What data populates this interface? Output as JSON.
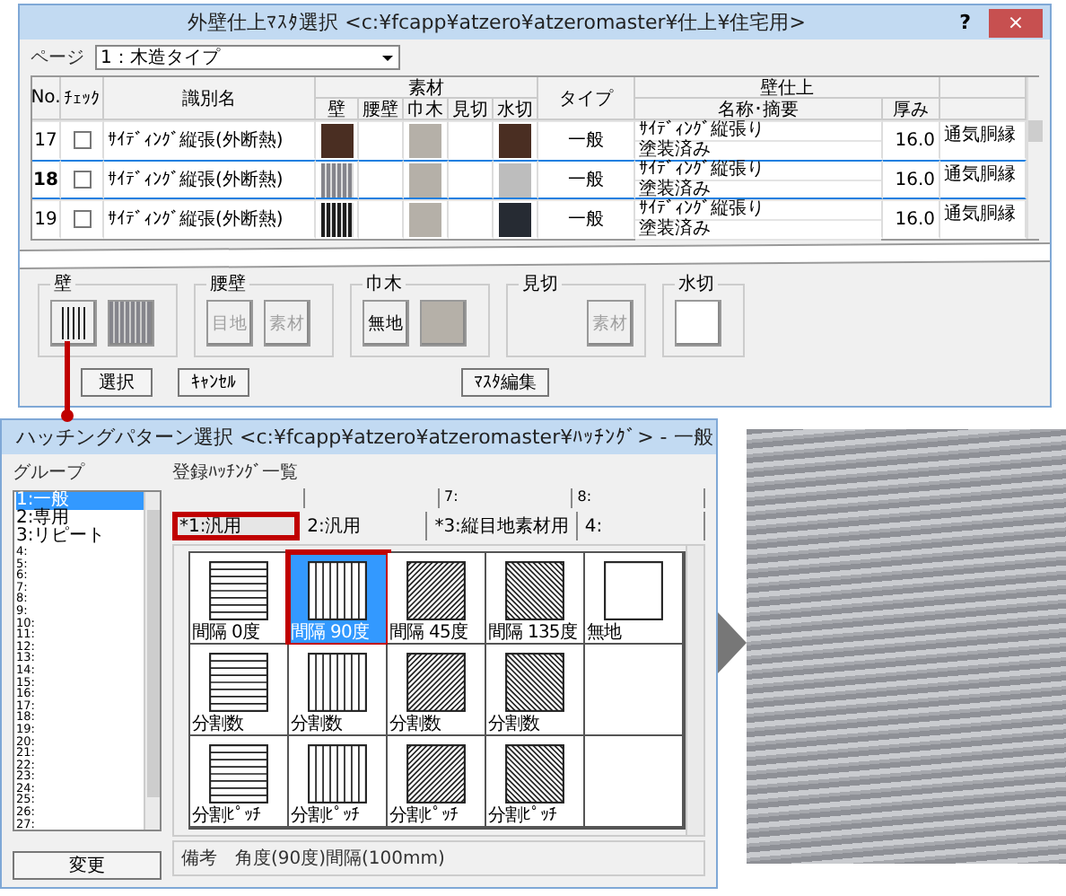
{
  "master_dialog": {
    "title": "外壁仕上ﾏｽﾀ選択 <c:¥fcapp¥atzero¥atzeromaster¥仕上¥住宅用>",
    "help": "?",
    "close": "×",
    "page": {
      "label": "ページ",
      "value": "1：木造タイプ"
    },
    "table": {
      "columns": {
        "no": "No.",
        "check": "ﾁｪｯｸ",
        "name": "識別名",
        "materials": "素材",
        "material_parts": [
          "壁",
          "腰壁",
          "巾木",
          "見切",
          "水切"
        ],
        "type": "タイプ",
        "finish": "壁仕上",
        "finish_name": "名称･摘要",
        "thickness": "厚み"
      },
      "rows": [
        {
          "no": "17",
          "checked": false,
          "selected": false,
          "name": "ｻｲﾃﾞｨﾝｸﾞ縦張(外断熱)",
          "swatches": [
            {
              "kind": "solid",
              "color": "#4a2e22"
            },
            {
              "kind": "none"
            },
            {
              "kind": "solid",
              "color": "#b5b0a8"
            },
            {
              "kind": "none"
            },
            {
              "kind": "solid",
              "color": "#4a2e22"
            }
          ],
          "type": "一般",
          "finish_lines": [
            "ｻｲﾃﾞｨﾝｸﾞ縦張り",
            "塗装済み"
          ],
          "thickness": "16.0",
          "column_extra": "通気胴縁"
        },
        {
          "no": "18",
          "checked": false,
          "selected": true,
          "name": "ｻｲﾃﾞｨﾝｸﾞ縦張(外断熱)",
          "swatches": [
            {
              "kind": "stripes",
              "color": "#85858c"
            },
            {
              "kind": "none"
            },
            {
              "kind": "solid",
              "color": "#b5b0a8"
            },
            {
              "kind": "none"
            },
            {
              "kind": "solid",
              "color": "#bdbdbd"
            }
          ],
          "type": "一般",
          "finish_lines": [
            "ｻｲﾃﾞｨﾝｸﾞ縦張り",
            "塗装済み"
          ],
          "thickness": "16.0",
          "column_extra": "通気胴縁"
        },
        {
          "no": "19",
          "checked": false,
          "selected": false,
          "name": "ｻｲﾃﾞｨﾝｸﾞ縦張(外断熱)",
          "swatches": [
            {
              "kind": "stripes",
              "color": "#1e1e1e"
            },
            {
              "kind": "none"
            },
            {
              "kind": "solid",
              "color": "#b5b0a8"
            },
            {
              "kind": "none"
            },
            {
              "kind": "solid",
              "color": "#262b33"
            }
          ],
          "type": "一般",
          "finish_lines": [
            "ｻｲﾃﾞｨﾝｸﾞ縦張り",
            "塗装済み"
          ],
          "thickness": "16.0",
          "column_extra": "通気胴縁"
        }
      ]
    },
    "groups": [
      {
        "title": "壁",
        "buttons": [
          {
            "kind": "hatch"
          },
          {
            "kind": "stripes",
            "color": "#85858c"
          }
        ]
      },
      {
        "title": "腰壁",
        "buttons": [
          {
            "kind": "text",
            "label": "目地",
            "disabled": true
          },
          {
            "kind": "text",
            "label": "素材",
            "disabled": true
          }
        ]
      },
      {
        "title": "巾木",
        "buttons": [
          {
            "kind": "text",
            "label": "無地",
            "disabled": false
          },
          {
            "kind": "solid",
            "color": "#b5b0a8"
          }
        ]
      },
      {
        "title": "見切",
        "buttons": [
          {
            "kind": "text",
            "label": "素材",
            "disabled": true
          }
        ]
      },
      {
        "title": "水切",
        "buttons": [
          {
            "kind": "solid",
            "color": "#ffffff"
          }
        ]
      }
    ],
    "actions": [
      "選択",
      "ｷｬﾝｾﾙ"
    ],
    "master_edit": "ﾏｽﾀ編集"
  },
  "hatch_dialog": {
    "title": "ハッチングパターン選択 <c:¥fcapp¥atzero¥atzeromaster¥ﾊｯﾁﾝｸﾞ> - 一般",
    "group_label": "グループ",
    "groups": [
      {
        "label": "1:一般",
        "selected": true
      },
      {
        "label": "2:専用",
        "selected": false
      },
      {
        "label": "3:リピート",
        "selected": false
      },
      {
        "label": "4:",
        "selected": false
      },
      {
        "label": "5:",
        "selected": false
      },
      {
        "label": "6:",
        "selected": false
      },
      {
        "label": "7:",
        "selected": false
      },
      {
        "label": "8:",
        "selected": false
      },
      {
        "label": "9:",
        "selected": false
      },
      {
        "label": "10:",
        "selected": false
      },
      {
        "label": "11:",
        "selected": false
      },
      {
        "label": "12:",
        "selected": false
      },
      {
        "label": "13:",
        "selected": false
      },
      {
        "label": "14:",
        "selected": false
      },
      {
        "label": "15:",
        "selected": false
      },
      {
        "label": "16:",
        "selected": false
      },
      {
        "label": "17:",
        "selected": false
      },
      {
        "label": "18:",
        "selected": false
      },
      {
        "label": "19:",
        "selected": false
      },
      {
        "label": "20:",
        "selected": false
      },
      {
        "label": "21:",
        "selected": false
      },
      {
        "label": "22:",
        "selected": false
      },
      {
        "label": "23:",
        "selected": false
      },
      {
        "label": "24:",
        "selected": false
      },
      {
        "label": "25:",
        "selected": false
      },
      {
        "label": "26:",
        "selected": false
      },
      {
        "label": "27:",
        "selected": false
      }
    ],
    "change_button": "変更",
    "list_label": "登録ﾊｯﾁﾝｸﾞ一覧",
    "back_tabs": [
      "7:",
      "8:"
    ],
    "tabs": [
      {
        "label": "*1:汎用",
        "selected": true
      },
      {
        "label": "2:汎用",
        "selected": false
      },
      {
        "label": "*3:縦目地素材用",
        "selected": false
      },
      {
        "label": "4:",
        "selected": false
      }
    ],
    "patterns": [
      {
        "kind": "horizontal",
        "label": "間隔 0度",
        "selected": false
      },
      {
        "kind": "vertical",
        "label": "間隔 90度",
        "selected": true
      },
      {
        "kind": "diag45",
        "label": "間隔 45度",
        "selected": false
      },
      {
        "kind": "diag135",
        "label": "間隔 135度",
        "selected": false
      },
      {
        "kind": "blank",
        "label": "無地",
        "selected": false
      },
      {
        "kind": "horizontal",
        "label": "分割数",
        "selected": false
      },
      {
        "kind": "vertical",
        "label": "分割数",
        "selected": false
      },
      {
        "kind": "diag45",
        "label": "分割数",
        "selected": false
      },
      {
        "kind": "diag135",
        "label": "分割数",
        "selected": false
      },
      {
        "kind": "empty"
      },
      {
        "kind": "horizontal",
        "label": "分割ﾋﾟｯﾁ",
        "selected": false
      },
      {
        "kind": "vertical",
        "label": "分割ﾋﾟｯﾁ",
        "selected": false
      },
      {
        "kind": "diag45",
        "label": "分割ﾋﾟｯﾁ",
        "selected": false
      },
      {
        "kind": "diag135",
        "label": "分割ﾋﾟｯﾁ",
        "selected": false
      },
      {
        "kind": "empty"
      }
    ],
    "note_label": "備考",
    "note": "角度(90度)間隔(100mm)"
  }
}
